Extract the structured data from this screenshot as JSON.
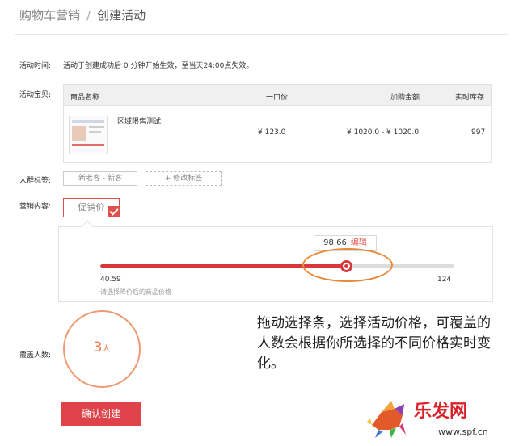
{
  "header": {
    "breadcrumb_parent": "购物车营销",
    "breadcrumb_sep": "/",
    "breadcrumb_current": "创建活动"
  },
  "form": {
    "time_label": "活动时间:",
    "time_value": "活动于创建成功后 0 分钟开始生效，至当天24:00点失效。",
    "product_label": "活动宝贝:",
    "audience_label": "人群标签:",
    "audience_tag": "新老客 - 新客",
    "audience_edit": "+ 修改标签",
    "content_label": "营销内容:",
    "content_option": "促销价",
    "coverage_label": "覆盖人数:",
    "confirm_button": "确认创建"
  },
  "table": {
    "headers": [
      "商品名称",
      "一口价",
      "加购金额",
      "实时库存"
    ],
    "row": {
      "name": "区域限售测试",
      "price": "¥ 123.0",
      "cart_amount": "¥ 1020.0 - ¥ 1020.0",
      "stock": "997"
    }
  },
  "slider": {
    "min_label": "40.59",
    "max_label": "124",
    "value_label": "98.66",
    "edit_label": "编辑",
    "hint": "请选择降价后的商品价格",
    "min": 40.59,
    "max": 124,
    "value": 98.66
  },
  "coverage": {
    "count": "3",
    "unit": "人"
  },
  "annotation": {
    "text": "拖动选择条，选择活动价格，可覆盖的人数会根据你所选择的不同价格实时变化。"
  },
  "watermark": {
    "site_text": "乐发网",
    "url": "www.spf.cn"
  },
  "colors": {
    "accent": "#d9383a",
    "highlight": "#e8893a",
    "button": "#e0424a"
  }
}
